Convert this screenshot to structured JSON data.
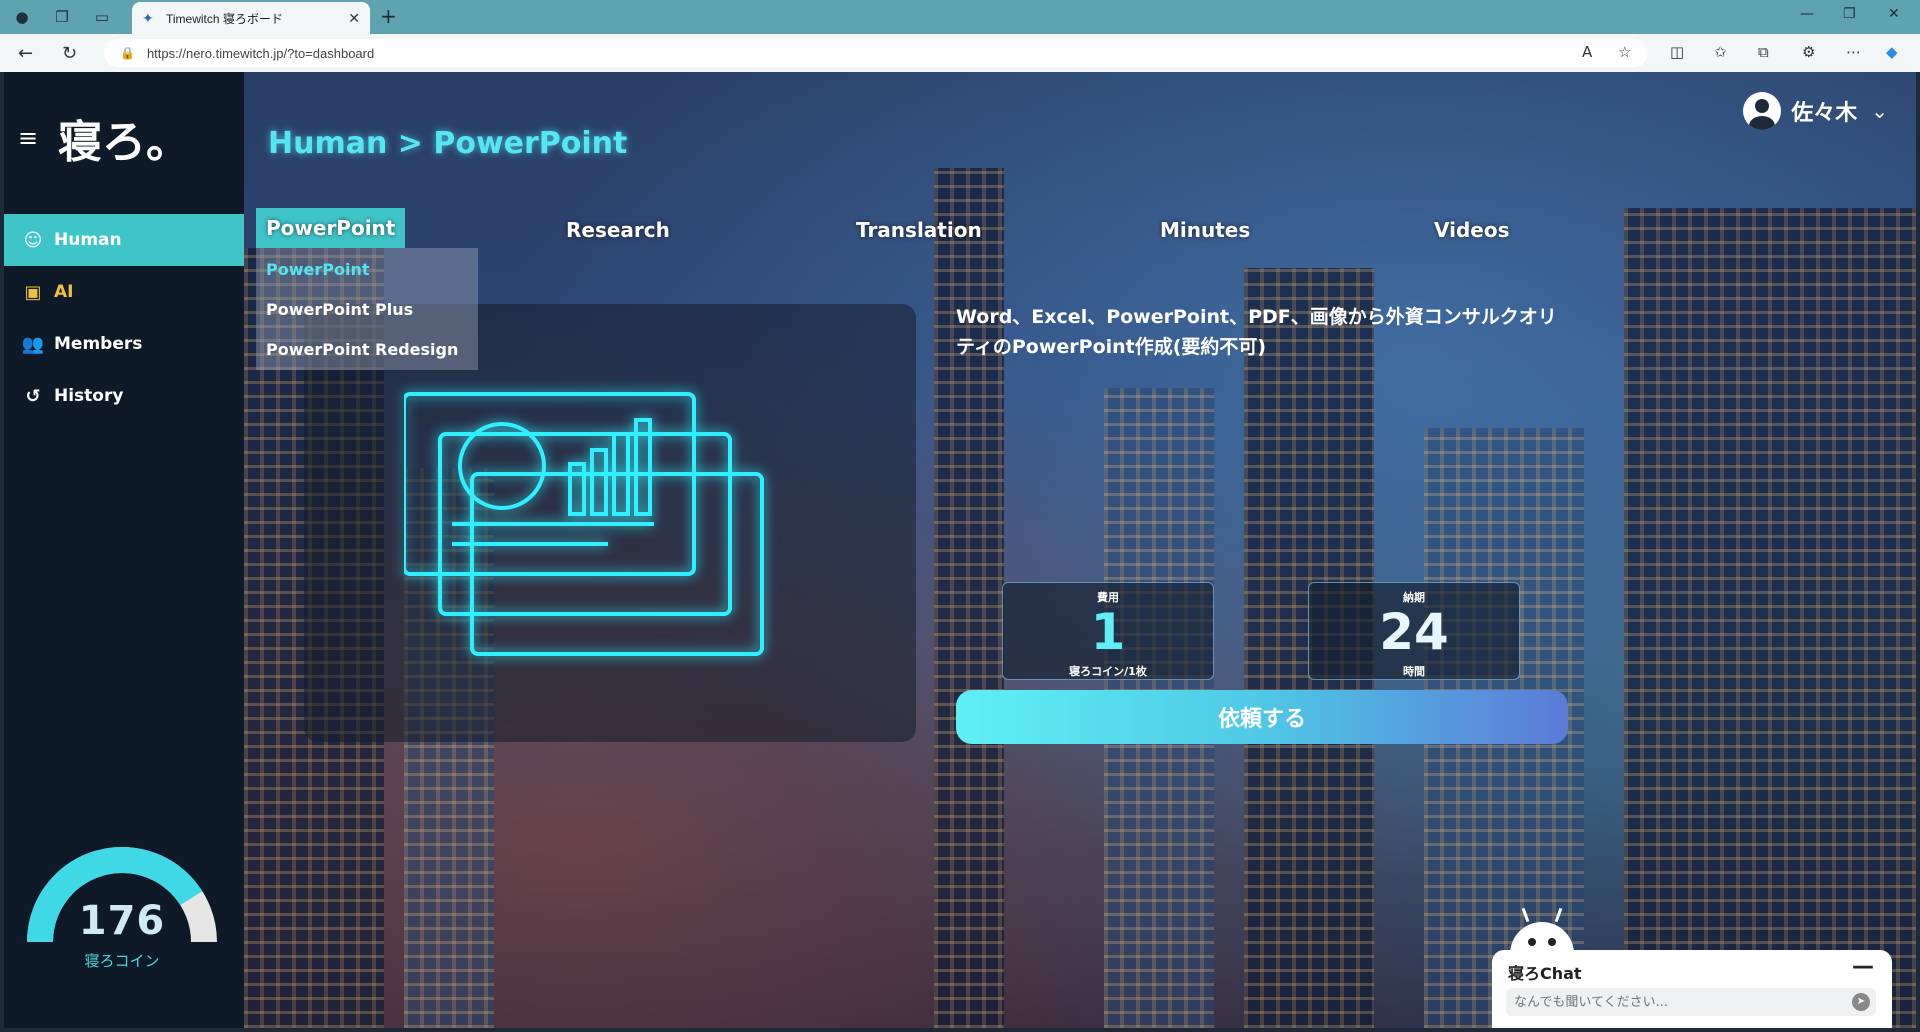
{
  "browser": {
    "tab_title": "Timewitch 寝ろボード",
    "url": "https://nero.timewitch.jp/?to=dashboard"
  },
  "sidebar": {
    "logo": "寝ろ。",
    "items": [
      {
        "label": "Human",
        "icon": "brain-head-icon",
        "active": true
      },
      {
        "label": "AI",
        "icon": "ai-chip-icon",
        "active": false
      },
      {
        "label": "Members",
        "icon": "members-icon",
        "active": false
      },
      {
        "label": "History",
        "icon": "history-icon",
        "active": false
      }
    ],
    "coins": {
      "value": "176",
      "label": "寝ろコイン",
      "level": 0.82
    }
  },
  "header": {
    "breadcrumb": "Human > PowerPoint",
    "user_name": "佐々木"
  },
  "categories": [
    "PowerPoint",
    "Research",
    "Translation",
    "Minutes",
    "Videos"
  ],
  "dropdown": [
    "PowerPoint",
    "PowerPoint Plus",
    "PowerPoint Redesign"
  ],
  "service": {
    "description": "Word、Excel、PowerPoint、PDF、画像から外資コンサルクオリティのPowerPoint作成(要約不可)",
    "cost_label": "費用",
    "cost_value": "1",
    "cost_unit": "寝ろコイン/1枚",
    "time_label": "納期",
    "time_value": "24",
    "time_unit": "時間",
    "request_button": "依頼する"
  },
  "chat": {
    "title": "寝ろChat",
    "placeholder": "なんでも聞いてください..."
  },
  "colors": {
    "accent": "#3fc4c8",
    "neon": "#55e6f2",
    "sidebar_bg": "#0e1a28"
  }
}
